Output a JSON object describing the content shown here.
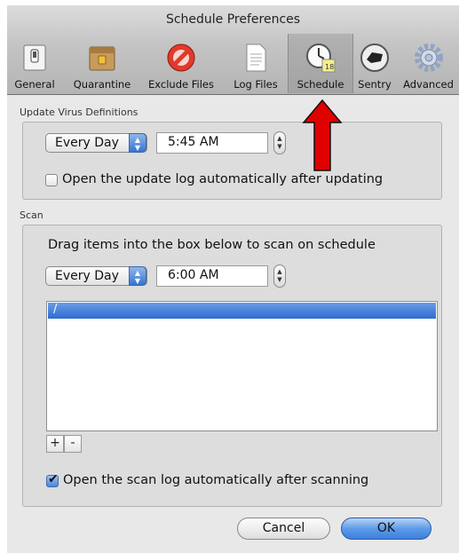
{
  "window": {
    "title": "Schedule Preferences"
  },
  "toolbar": {
    "items": [
      {
        "label": "General",
        "icon": "general-switch-icon"
      },
      {
        "label": "Quarantine",
        "icon": "quarantine-box-icon"
      },
      {
        "label": "Exclude Files",
        "icon": "no-sign-icon"
      },
      {
        "label": "Log Files",
        "icon": "document-icon"
      },
      {
        "label": "Schedule",
        "icon": "clock-calendar-icon",
        "selected": true
      },
      {
        "label": "Sentry",
        "icon": "sentry-icon"
      },
      {
        "label": "Advanced",
        "icon": "gear-icon"
      }
    ]
  },
  "update": {
    "section_label": "Update Virus Definitions",
    "frequency": "Every Day",
    "time": "5:45 AM",
    "open_log_label": "Open the update log automatically after updating",
    "open_log_checked": false
  },
  "scan": {
    "section_label": "Scan",
    "instructions": "Drag items into the box below to scan on schedule",
    "frequency": "Every Day",
    "time": "6:00 AM",
    "items": [
      "/"
    ],
    "add_label": "+",
    "remove_label": "-",
    "open_log_label": "Open the scan log automatically after scanning",
    "open_log_checked": true
  },
  "buttons": {
    "cancel": "Cancel",
    "ok": "OK"
  },
  "colors": {
    "accent": "#3c7fdc",
    "annotation_arrow": "#e00000"
  }
}
